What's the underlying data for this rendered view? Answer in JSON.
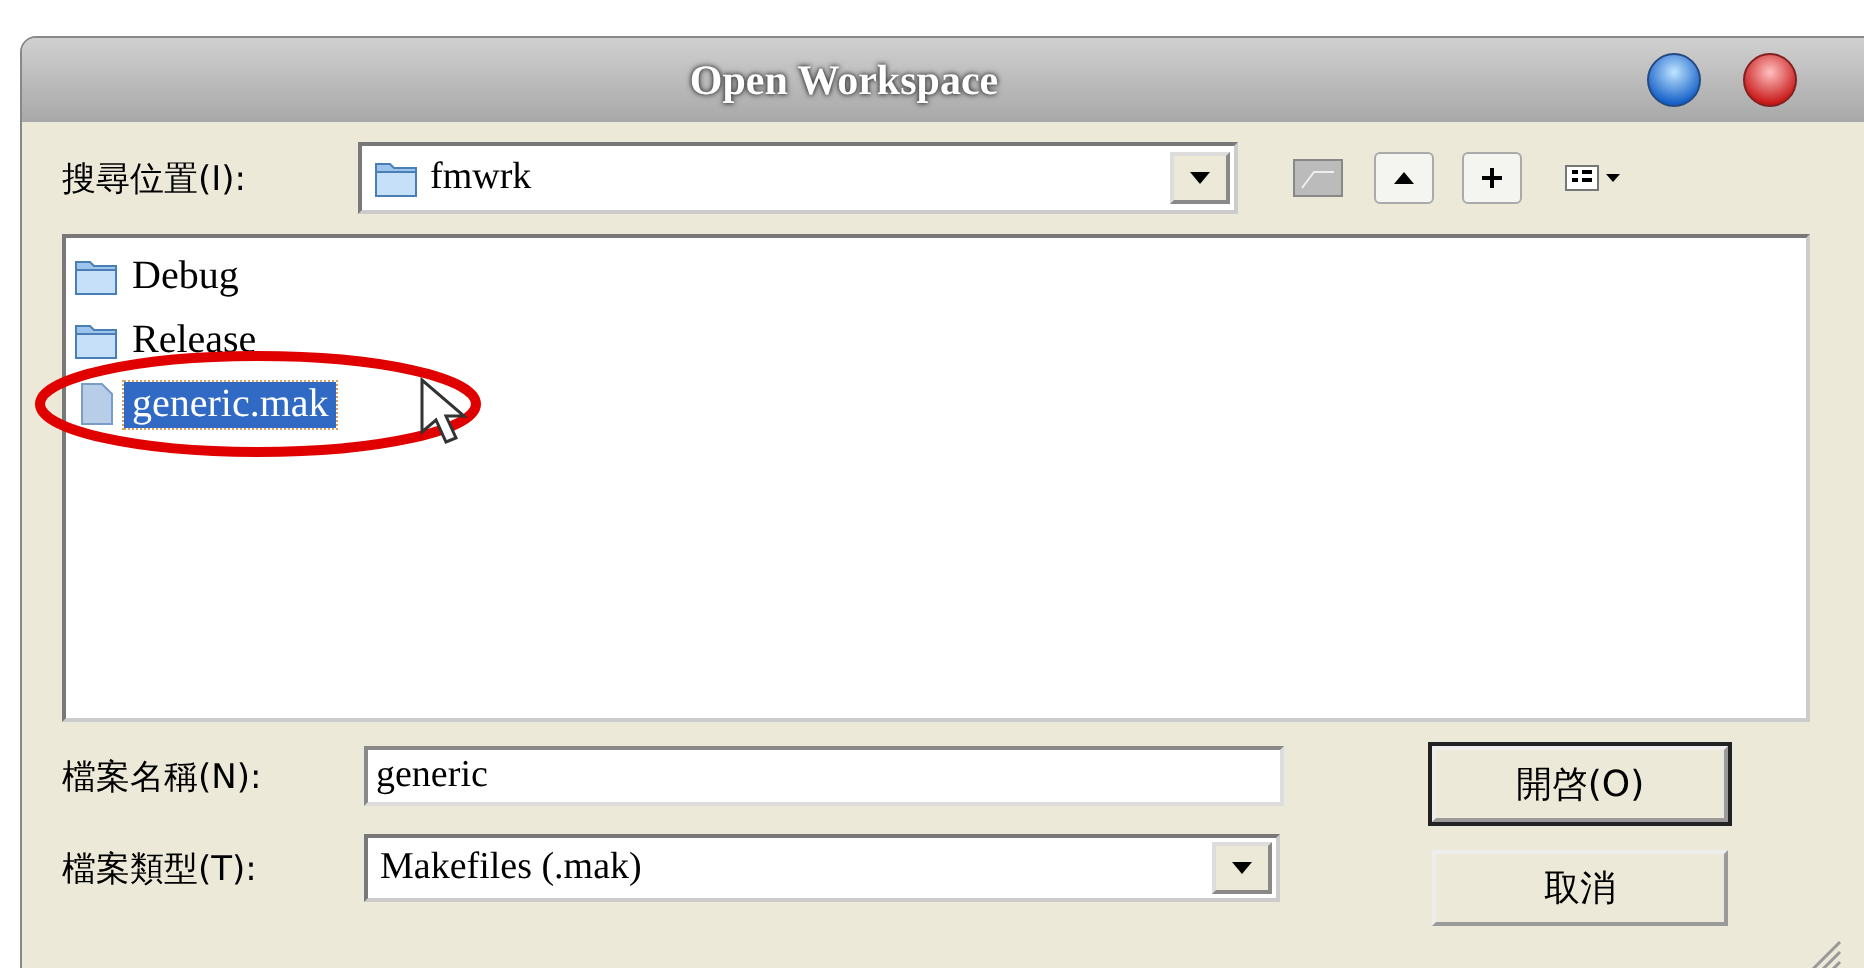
{
  "window": {
    "title": "Open Workspace"
  },
  "look_in": {
    "label": "搜尋位置(I):",
    "value": "fmwrk"
  },
  "files": [
    {
      "name": "Debug",
      "kind": "folder",
      "selected": false
    },
    {
      "name": "Release",
      "kind": "folder",
      "selected": false
    },
    {
      "name": "generic.mak",
      "kind": "file",
      "selected": true
    }
  ],
  "file_name": {
    "label": "檔案名稱(N):",
    "value": "generic"
  },
  "file_type": {
    "label": "檔案類型(T):",
    "value": "Makefiles (.mak)"
  },
  "buttons": [
    "開啓(O)",
    "取消"
  ]
}
